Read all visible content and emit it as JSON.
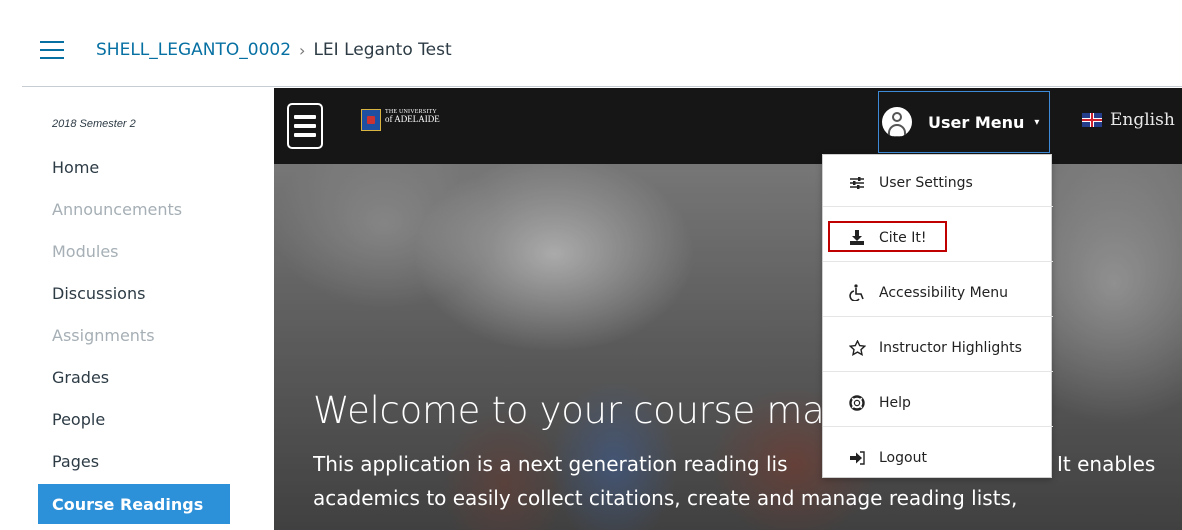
{
  "canvas": {
    "breadcrumb": {
      "course_code": "SHELL_LEGANTO_0002",
      "separator": "›",
      "current": "LEI Leganto Test"
    }
  },
  "course_nav": {
    "term": "2018 Semester 2",
    "items": [
      {
        "label": "Home",
        "state": "enabled"
      },
      {
        "label": "Announcements",
        "state": "disabled"
      },
      {
        "label": "Modules",
        "state": "disabled"
      },
      {
        "label": "Discussions",
        "state": "enabled"
      },
      {
        "label": "Assignments",
        "state": "disabled"
      },
      {
        "label": "Grades",
        "state": "enabled"
      },
      {
        "label": "People",
        "state": "enabled"
      },
      {
        "label": "Pages",
        "state": "enabled"
      },
      {
        "label": "Course Readings",
        "state": "active"
      }
    ]
  },
  "leganto": {
    "logo_line1": "THE UNIVERSITY",
    "logo_line2": "of ADELAIDE",
    "user_menu_label": "User Menu",
    "caret": "▾",
    "language": "English",
    "hero": {
      "welcome": "Welcome to your course mat",
      "desc_line1_left": "This application is a next generation reading lis",
      "desc_line1_right": "It enables",
      "desc_line2": "academics to easily collect citations, create and manage reading lists,"
    },
    "user_dropdown": [
      {
        "label": "User Settings",
        "icon": "sliders-icon"
      },
      {
        "label": "Cite It!",
        "icon": "download-icon",
        "highlighted": true
      },
      {
        "label": "Accessibility Menu",
        "icon": "accessibility-icon"
      },
      {
        "label": "Instructor Highlights",
        "icon": "star-icon"
      },
      {
        "label": "Help",
        "icon": "lifebuoy-icon"
      },
      {
        "label": "Logout",
        "icon": "logout-icon"
      }
    ]
  },
  "colors": {
    "canvas_link": "#0770a3",
    "nav_active_bg": "#2d91d9",
    "leganto_bar": "#161616",
    "cite_highlight": "#c00000",
    "user_menu_border": "#3d8bd8"
  }
}
